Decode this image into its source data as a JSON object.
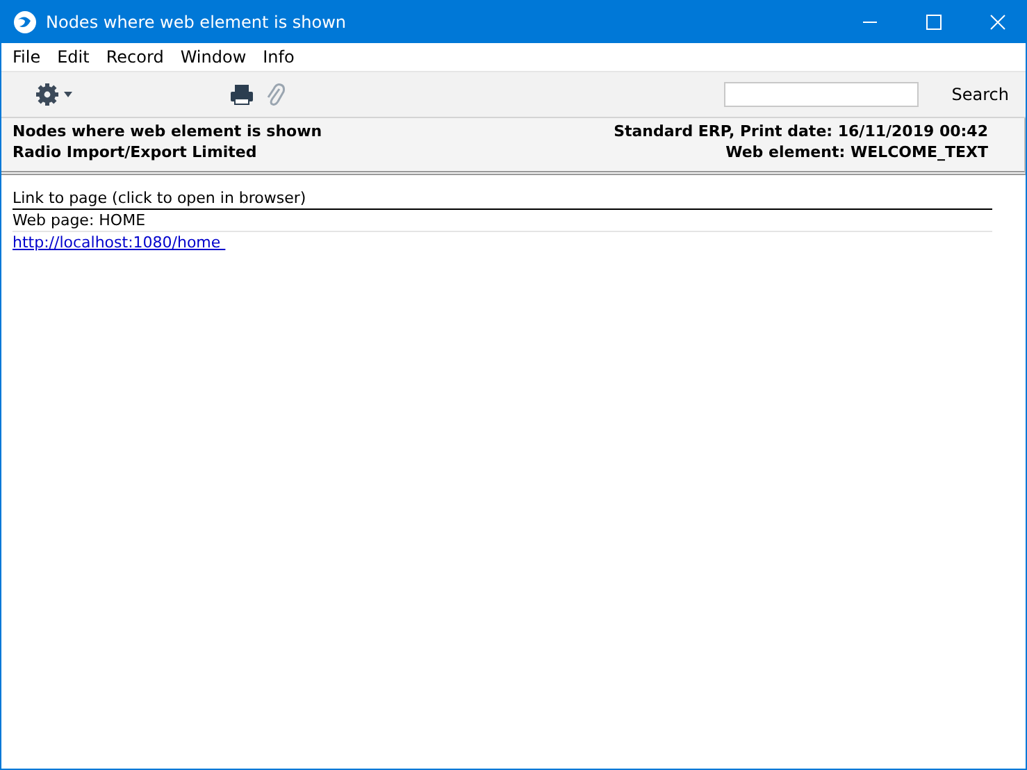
{
  "window": {
    "title": "Nodes where web element is shown"
  },
  "menu": [
    "File",
    "Edit",
    "Record",
    "Window",
    "Info"
  ],
  "toolbar": {
    "search_button": "Search"
  },
  "report_header": {
    "title": "Nodes where web element is shown",
    "company": "Radio Import/Export Limited",
    "system": "Standard ERP, Print date: 16/11/2019 00:42",
    "web_element": "Web element: WELCOME_TEXT"
  },
  "report": {
    "column_header": "Link to page (click to open in browser)",
    "rows": [
      {
        "kind": "label",
        "text": "Web page: HOME"
      },
      {
        "kind": "link",
        "text": "http://localhost:1080/home "
      }
    ]
  }
}
